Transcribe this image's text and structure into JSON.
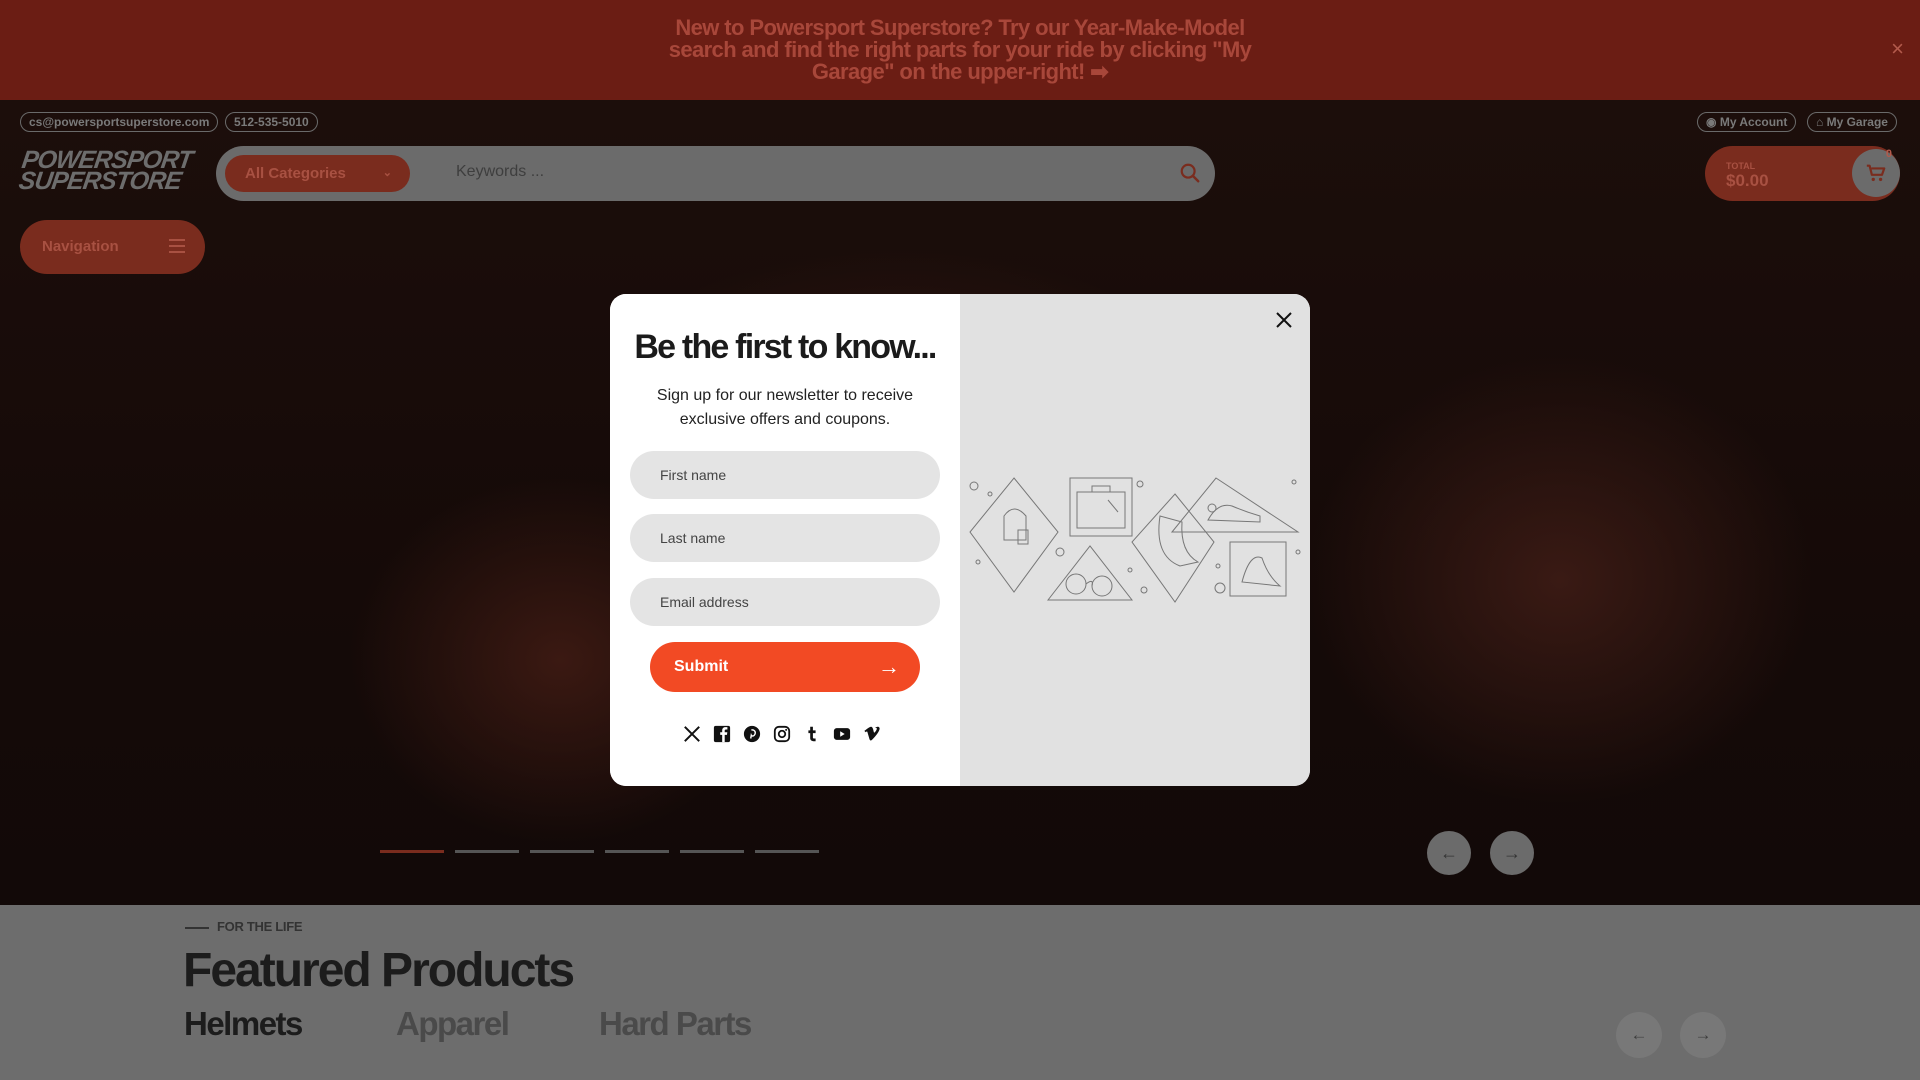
{
  "announcement": {
    "text": "New to Powersport Superstore? Try our Year-Make-Model search and find the right parts for your ride by clicking \"My Garage\" on the upper-right! ➡",
    "close": "×"
  },
  "topbar": {
    "email": "cs@powersportsuperstore.com",
    "phone": "512-535-5010",
    "account": "My Account",
    "garage": "My Garage"
  },
  "logo": {
    "line1": "POWERSPORT",
    "line2": "SUPERSTORE"
  },
  "search": {
    "category": "All Categories",
    "placeholder": "Keywords ..."
  },
  "cart": {
    "total_label": "TOTAL",
    "total": "$0.00",
    "count": "0"
  },
  "navigation": {
    "label": "Navigation"
  },
  "hero": {
    "slides": 6,
    "active_slide": 1
  },
  "featured": {
    "eyebrow": "FOR THE LIFE",
    "title": "Featured Products",
    "tabs": [
      {
        "label": "Helmets",
        "active": true
      },
      {
        "label": "Apparel",
        "active": false
      },
      {
        "label": "Hard Parts",
        "active": false
      }
    ]
  },
  "modal": {
    "title": "Be the first to know...",
    "subtitle": "Sign up for our newsletter to receive exclusive offers and coupons.",
    "first_name_placeholder": "First name",
    "last_name_placeholder": "Last name",
    "email_placeholder": "Email address",
    "submit": "Submit",
    "socials": [
      "x-icon",
      "facebook-icon",
      "pinterest-icon",
      "instagram-icon",
      "tumblr-icon",
      "youtube-icon",
      "vimeo-icon"
    ]
  },
  "colors": {
    "accent": "#f24a24",
    "announcement_bg": "#6b1d14",
    "modal_illustration_bg": "#e1e1e1"
  }
}
